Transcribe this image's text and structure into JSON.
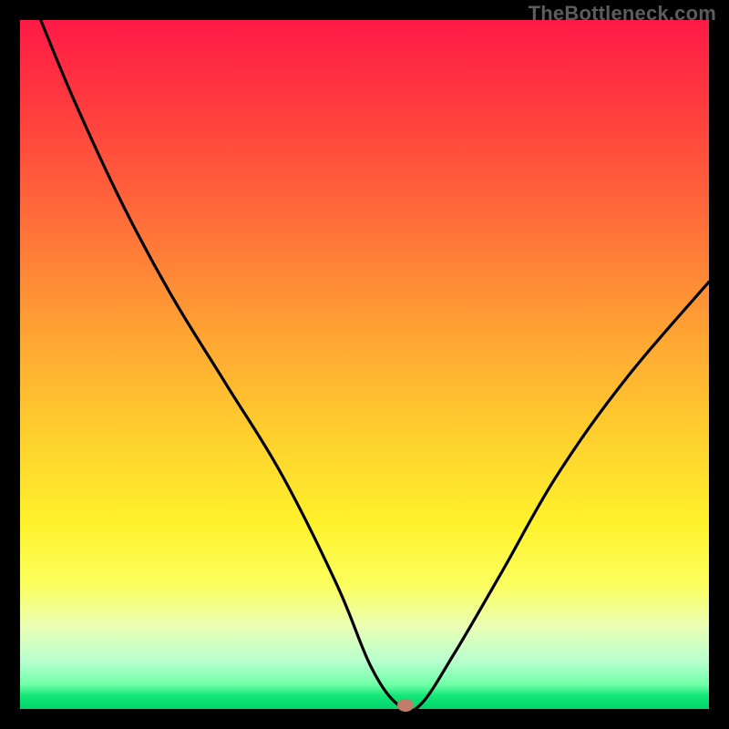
{
  "watermark": "TheBottleneck.com",
  "chart_data": {
    "type": "line",
    "title": "",
    "xlabel": "",
    "ylabel": "",
    "xlim": [
      0,
      100
    ],
    "ylim": [
      0,
      100
    ],
    "grid": false,
    "legend": false,
    "marker": {
      "x_pct": 56.0,
      "y_pct": 0.5
    },
    "series": [
      {
        "name": "curve",
        "x": [
          3,
          8,
          15,
          22,
          30,
          38,
          46,
          51,
          55,
          58,
          63,
          70,
          78,
          88,
          100
        ],
        "y": [
          100,
          88,
          73,
          60,
          47,
          34,
          18,
          6,
          0.5,
          0.5,
          8,
          20,
          34,
          48,
          62
        ]
      }
    ]
  },
  "colors": {
    "curve": "#000000",
    "marker": "#c17d6a",
    "background_top": "#ff1a47",
    "background_bottom": "#00d56a"
  }
}
